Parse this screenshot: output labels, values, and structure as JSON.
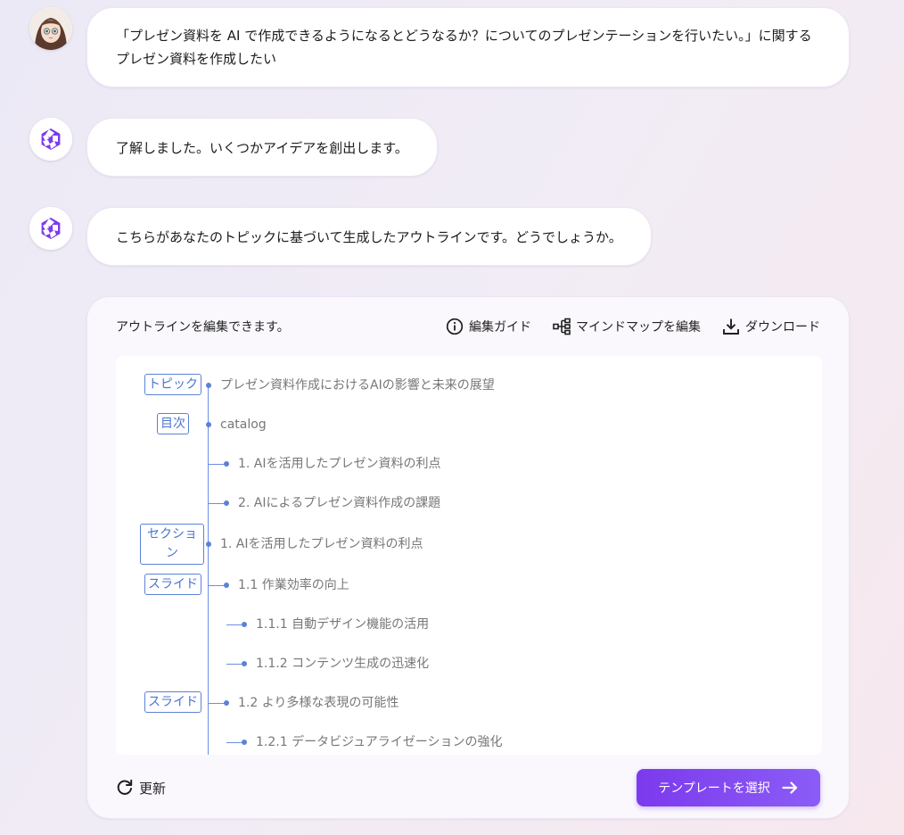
{
  "messages": [
    {
      "role": "user",
      "text": "「プレゼン資料を AI で作成できるようになるとどうなるか？についてのプレゼンテーションを行いたい。」に関するプレゼン資料を作成したい"
    },
    {
      "role": "assistant",
      "text": "了解しました。いくつかアイデアを創出します。"
    },
    {
      "role": "assistant",
      "text": "こちらがあなたのトピックに基づいて生成したアウトラインです。どうでしょうか。"
    }
  ],
  "card": {
    "hint": "アウトラインを編集できます。",
    "tools": {
      "guide": "編集ガイド",
      "mindmap": "マインドマップを編集",
      "download": "ダウンロード"
    },
    "outline": {
      "rows": [
        {
          "tag": "トピック",
          "text": "プレゼン資料作成におけるAIの影響と未来の展望"
        },
        {
          "tag": "目次",
          "text": "catalog"
        },
        {
          "tag": "",
          "text": "1. AIを活用したプレゼン資料の利点"
        },
        {
          "tag": "",
          "text": "2. AIによるプレゼン資料作成の課題"
        },
        {
          "tag": "セクション",
          "text": "1. AIを活用したプレゼン資料の利点"
        },
        {
          "tag": "スライド",
          "text": "1.1 作業効率の向上"
        },
        {
          "tag": "",
          "text": "1.1.1 自動デザイン機能の活用"
        },
        {
          "tag": "",
          "text": "1.1.2 コンテンツ生成の迅速化"
        },
        {
          "tag": "スライド",
          "text": "1.2 より多様な表現の可能性"
        },
        {
          "tag": "",
          "text": "1.2.1 データビジュアライゼーションの強化"
        }
      ]
    },
    "refresh_label": "更新",
    "cta_label": "テンプレートを選択"
  },
  "colors": {
    "accent": "#7c3aed",
    "outline_blue": "#5b82d8",
    "text_muted": "#777777"
  },
  "icons": [
    "user-avatar-icon",
    "assistant-logo-icon",
    "info-icon",
    "mindmap-icon",
    "download-icon",
    "refresh-icon",
    "arrow-right-icon"
  ]
}
